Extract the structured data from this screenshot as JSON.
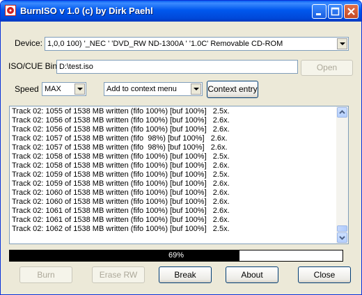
{
  "window": {
    "title": "BurnISO v 1.0 (c) by Dirk Paehl"
  },
  "device": {
    "label": "Device:",
    "value": "1,0,0 100) '_NEC    ' 'DVD_RW ND-1300A ' '1.0C' Removable CD-ROM"
  },
  "iso": {
    "label": "ISO/CUE Bin",
    "value": "D:\\test.iso",
    "open_label": "Open"
  },
  "speed": {
    "label": "Speed",
    "value": "MAX"
  },
  "context": {
    "value": "Add to context menu",
    "entry_label": "Context entry"
  },
  "log": {
    "lines": [
      "Track 02: 1055 of 1538 MB written (fifo 100%) [buf 100%]   2.5x.",
      "Track 02: 1056 of 1538 MB written (fifo 100%) [buf 100%]   2.6x.",
      "Track 02: 1056 of 1538 MB written (fifo 100%) [buf 100%]   2.6x.",
      "Track 02: 1057 of 1538 MB written (fifo  98%) [buf 100%]   2.6x.",
      "Track 02: 1057 of 1538 MB written (fifo  98%) [buf 100%]   2.6x.",
      "Track 02: 1058 of 1538 MB written (fifo 100%) [buf 100%]   2.5x.",
      "Track 02: 1058 of 1538 MB written (fifo 100%) [buf 100%]   2.6x.",
      "Track 02: 1059 of 1538 MB written (fifo 100%) [buf 100%]   2.5x.",
      "Track 02: 1059 of 1538 MB written (fifo 100%) [buf 100%]   2.6x.",
      "Track 02: 1060 of 1538 MB written (fifo 100%) [buf 100%]   2.6x.",
      "Track 02: 1060 of 1538 MB written (fifo 100%) [buf 100%]   2.6x.",
      "Track 02: 1061 of 1538 MB written (fifo 100%) [buf 100%]   2.6x.",
      "Track 02: 1061 of 1538 MB written (fifo 100%) [buf 100%]   2.6x.",
      "Track 02: 1062 of 1538 MB written (fifo 100%) [buf 100%]   2.5x."
    ]
  },
  "progress": {
    "percent": 69,
    "label": "69%"
  },
  "buttons": {
    "burn": "Burn",
    "erase": "Erase RW",
    "break": "Break",
    "about": "About",
    "close": "Close"
  }
}
